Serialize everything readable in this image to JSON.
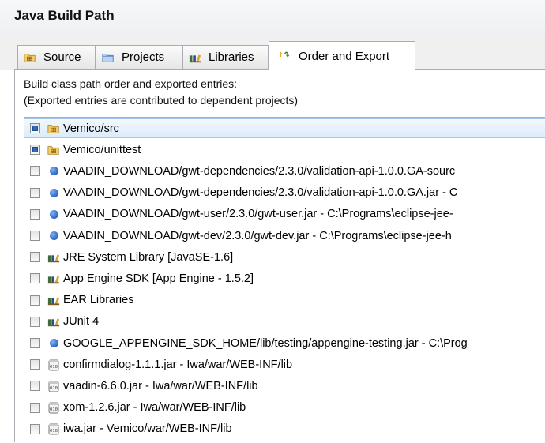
{
  "header": {
    "title": "Java Build Path"
  },
  "tabs": [
    {
      "label": "Source",
      "icon": "source-folder-icon",
      "active": false
    },
    {
      "label": "Projects",
      "icon": "projects-icon",
      "active": false
    },
    {
      "label": "Libraries",
      "icon": "libraries-icon",
      "active": false
    },
    {
      "label": "Order and Export",
      "icon": "order-export-icon",
      "active": true
    }
  ],
  "description": {
    "line1": "Build class path order and exported entries:",
    "line2": "(Exported entries are contributed to dependent projects)"
  },
  "entries": [
    {
      "label": "Vemico/src",
      "icon": "source-folder-icon",
      "checked": true,
      "selected": true
    },
    {
      "label": "Vemico/unittest",
      "icon": "source-folder-icon",
      "checked": true,
      "selected": false
    },
    {
      "label": "VAADIN_DOWNLOAD/gwt-dependencies/2.3.0/validation-api-1.0.0.GA-sourc",
      "icon": "classpath-variable-icon",
      "checked": false,
      "selected": false
    },
    {
      "label": "VAADIN_DOWNLOAD/gwt-dependencies/2.3.0/validation-api-1.0.0.GA.jar - C",
      "icon": "classpath-variable-icon",
      "checked": false,
      "selected": false
    },
    {
      "label": "VAADIN_DOWNLOAD/gwt-user/2.3.0/gwt-user.jar - C:\\Programs\\eclipse-jee-",
      "icon": "classpath-variable-icon",
      "checked": false,
      "selected": false
    },
    {
      "label": "VAADIN_DOWNLOAD/gwt-dev/2.3.0/gwt-dev.jar - C:\\Programs\\eclipse-jee-h",
      "icon": "classpath-variable-icon",
      "checked": false,
      "selected": false
    },
    {
      "label": "JRE System Library [JavaSE-1.6]",
      "icon": "library-icon",
      "checked": false,
      "selected": false
    },
    {
      "label": "App Engine SDK [App Engine - 1.5.2]",
      "icon": "library-icon",
      "checked": false,
      "selected": false
    },
    {
      "label": "EAR Libraries",
      "icon": "library-icon",
      "checked": false,
      "selected": false
    },
    {
      "label": "JUnit 4",
      "icon": "library-icon",
      "checked": false,
      "selected": false
    },
    {
      "label": "GOOGLE_APPENGINE_SDK_HOME/lib/testing/appengine-testing.jar - C:\\Prog",
      "icon": "classpath-variable-icon",
      "checked": false,
      "selected": false
    },
    {
      "label": "confirmdialog-1.1.1.jar - Iwa/war/WEB-INF/lib",
      "icon": "jar-icon",
      "checked": false,
      "selected": false
    },
    {
      "label": "vaadin-6.6.0.jar - Iwa/war/WEB-INF/lib",
      "icon": "jar-icon",
      "checked": false,
      "selected": false
    },
    {
      "label": "xom-1.2.6.jar - Iwa/war/WEB-INF/lib",
      "icon": "jar-icon",
      "checked": false,
      "selected": false
    },
    {
      "label": "iwa.jar - Vemico/war/WEB-INF/lib",
      "icon": "jar-icon",
      "checked": false,
      "selected": false
    }
  ]
}
